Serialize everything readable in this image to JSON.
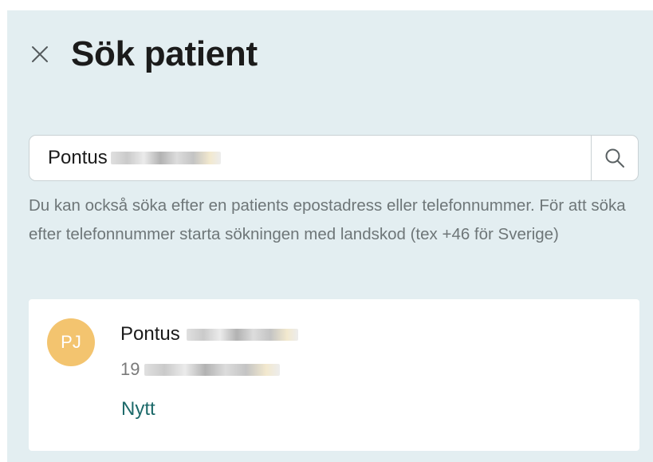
{
  "header": {
    "title": "Sök patient",
    "close_icon": "close-icon"
  },
  "search": {
    "value": "Pontus",
    "icon": "search-icon"
  },
  "helper_text": "Du kan också söka efter en patients epostadress eller telefonnummer. För att söka efter telefonnummer starta sökningen med landskod (tex +46 för Sverige)",
  "results": [
    {
      "initials": "PJ",
      "first_name": "Pontus",
      "pnr_prefix": "19",
      "status": "Nytt",
      "avatar_color": "#f3c46f",
      "status_color": "#1d6a6a"
    }
  ],
  "colors": {
    "panel_background": "#e3eef1",
    "card_background": "#ffffff"
  }
}
